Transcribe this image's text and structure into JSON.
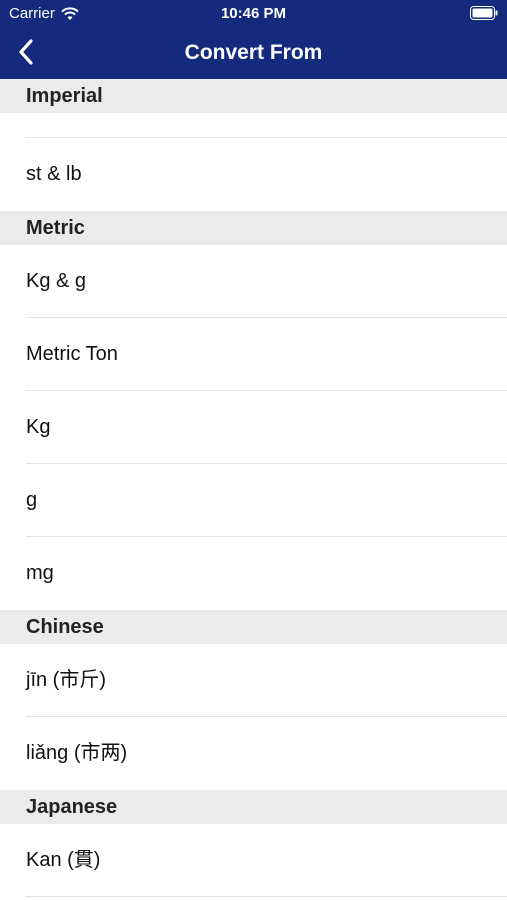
{
  "status_bar": {
    "carrier": "Carrier",
    "time": "10:46 PM"
  },
  "nav": {
    "title": "Convert From"
  },
  "colors": {
    "header_bg": "#132a7d",
    "section_bg": "#ebebeb",
    "separator": "#e2e2e2"
  },
  "sections": {
    "imperial": {
      "title": "Imperial",
      "items": [
        "",
        "st & lb"
      ]
    },
    "metric": {
      "title": "Metric",
      "items": [
        "Kg & g",
        "Metric Ton",
        "Kg",
        "g",
        "mg"
      ]
    },
    "chinese": {
      "title": "Chinese",
      "items": [
        "jīn (市斤)",
        "liǎng (市两)"
      ]
    },
    "japanese": {
      "title": "Japanese",
      "items": [
        "Kan (貫)"
      ]
    }
  }
}
